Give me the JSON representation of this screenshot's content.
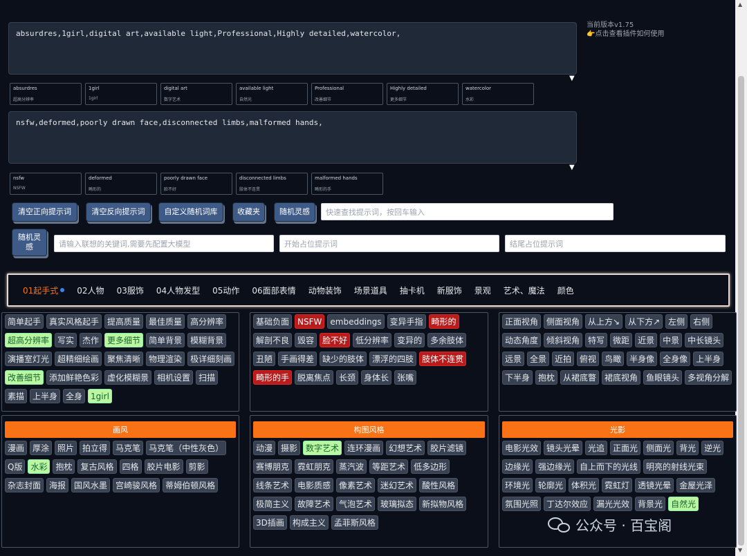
{
  "version": "当前版本v1.75",
  "guide_link": "👉点击查看插件如何使用",
  "positive_prompt": "absurdres,1girl,digital art,available  light,Professional,Highly detailed,watercolor,",
  "negative_prompt": "nsfw,deformed,poorly drawn face,disconnected limbs,malformed hands,",
  "dropdown_glyph": "▼",
  "positive_tags": [
    {
      "en": "absurdres",
      "cn": "超高分辨率"
    },
    {
      "en": "1girl",
      "cn": "1girl"
    },
    {
      "en": "digital art",
      "cn": "数字艺术"
    },
    {
      "en": "available light",
      "cn": "自然光"
    },
    {
      "en": "Professional",
      "cn": "改善细节"
    },
    {
      "en": "Highly detailed",
      "cn": "更多细节"
    },
    {
      "en": "watercolor",
      "cn": "水彩"
    }
  ],
  "negative_tags": [
    {
      "en": "nsfw",
      "cn": "NSFW"
    },
    {
      "en": "deformed",
      "cn": "畸形的"
    },
    {
      "en": "poorly drawn face",
      "cn": "脸不好"
    },
    {
      "en": "disconnected limbs",
      "cn": "肢体不连贯"
    },
    {
      "en": "malformed hands",
      "cn": "畸形的手"
    }
  ],
  "buttons": {
    "clear_positive": "清空正向提示词",
    "clear_negative": "清空反向提示词",
    "custom_random": "自定义随机词库",
    "favorites": "收藏夹",
    "random_inspiration": "随机灵感",
    "random_inspiration2": "随机灵感"
  },
  "inputs": {
    "quick_search": "快速查找提示词，按回车输入",
    "llm_keyword": "请输入联想的关键词,需要先配置大模型",
    "start_placeholder": "开始占位提示词",
    "end_placeholder": "结尾占位提示词"
  },
  "tabs": [
    "01起手式",
    "02人物",
    "03服饰",
    "04人物发型",
    "05动作",
    "06面部表情",
    "动物装饰",
    "场景道具",
    "抽卡机",
    "新服饰",
    "景观",
    "艺术、魔法",
    "颜色"
  ],
  "panels": {
    "p1": {
      "chips": [
        {
          "t": "简单起手",
          "s": ""
        },
        {
          "t": "真实风格起手",
          "s": ""
        },
        {
          "t": "提高质量",
          "s": ""
        },
        {
          "t": "最佳质量",
          "s": ""
        },
        {
          "t": "高分辨率",
          "s": ""
        },
        {
          "t": "超高分辨率",
          "s": "green"
        },
        {
          "t": "写实",
          "s": ""
        },
        {
          "t": "杰作",
          "s": ""
        },
        {
          "t": "更多细节",
          "s": "green"
        },
        {
          "t": "简单背景",
          "s": ""
        },
        {
          "t": "模糊背景",
          "s": ""
        },
        {
          "t": "演播室灯光",
          "s": ""
        },
        {
          "t": "超精细绘画",
          "s": ""
        },
        {
          "t": "聚焦清晰",
          "s": ""
        },
        {
          "t": "物理渲染",
          "s": ""
        },
        {
          "t": "极详细刻画",
          "s": ""
        },
        {
          "t": "改善细节",
          "s": "green"
        },
        {
          "t": "添加鲜艳色彩",
          "s": ""
        },
        {
          "t": "虚化模糊景",
          "s": ""
        },
        {
          "t": "相机设置",
          "s": ""
        },
        {
          "t": "扫描",
          "s": ""
        },
        {
          "t": "素描",
          "s": ""
        },
        {
          "t": "上半身",
          "s": ""
        },
        {
          "t": "全身",
          "s": ""
        },
        {
          "t": "1girl",
          "s": "green"
        }
      ]
    },
    "p2": {
      "chips": [
        {
          "t": "基础负面",
          "s": ""
        },
        {
          "t": "NSFW",
          "s": "red"
        },
        {
          "t": "embeddings",
          "s": ""
        },
        {
          "t": "变异手指",
          "s": ""
        },
        {
          "t": "畸形的",
          "s": "red"
        },
        {
          "t": "解剖不良",
          "s": ""
        },
        {
          "t": "毁容",
          "s": ""
        },
        {
          "t": "脸不好",
          "s": "red"
        },
        {
          "t": "低分辨率",
          "s": ""
        },
        {
          "t": "变异的",
          "s": ""
        },
        {
          "t": "多余肢体",
          "s": ""
        },
        {
          "t": "丑陋",
          "s": ""
        },
        {
          "t": "手画得差",
          "s": ""
        },
        {
          "t": "缺少的肢体",
          "s": ""
        },
        {
          "t": "漂浮的四肢",
          "s": ""
        },
        {
          "t": "肢体不连贯",
          "s": "red"
        },
        {
          "t": "畸形的手",
          "s": "red"
        },
        {
          "t": "脱离焦点",
          "s": ""
        },
        {
          "t": "长颈",
          "s": ""
        },
        {
          "t": "身体长",
          "s": ""
        },
        {
          "t": "张嘴",
          "s": ""
        }
      ]
    },
    "p3": {
      "chips": [
        {
          "t": "正面视角",
          "s": ""
        },
        {
          "t": "侧面视角",
          "s": ""
        },
        {
          "t": "从上方↘",
          "s": ""
        },
        {
          "t": "从下方↗",
          "s": ""
        },
        {
          "t": "左侧",
          "s": ""
        },
        {
          "t": "右侧",
          "s": ""
        },
        {
          "t": "动态角度",
          "s": ""
        },
        {
          "t": "倾斜视角",
          "s": ""
        },
        {
          "t": "特写",
          "s": ""
        },
        {
          "t": "微距",
          "s": ""
        },
        {
          "t": "近景",
          "s": ""
        },
        {
          "t": "中景",
          "s": ""
        },
        {
          "t": "中长镜头",
          "s": ""
        },
        {
          "t": "远景",
          "s": ""
        },
        {
          "t": "全景",
          "s": ""
        },
        {
          "t": "近拍",
          "s": ""
        },
        {
          "t": "俯视",
          "s": ""
        },
        {
          "t": "鸟瞰",
          "s": ""
        },
        {
          "t": "半身像",
          "s": ""
        },
        {
          "t": "全身像",
          "s": ""
        },
        {
          "t": "上半身",
          "s": ""
        },
        {
          "t": "下半身",
          "s": ""
        },
        {
          "t": "抱枕",
          "s": ""
        },
        {
          "t": "从裙底瞥",
          "s": ""
        },
        {
          "t": "裙底视角",
          "s": ""
        },
        {
          "t": "鱼眼镜头",
          "s": ""
        },
        {
          "t": "多视角分解",
          "s": ""
        }
      ]
    },
    "p4": {
      "title": "画风",
      "chips": [
        {
          "t": "漫画",
          "s": ""
        },
        {
          "t": "厚涂",
          "s": ""
        },
        {
          "t": "照片",
          "s": ""
        },
        {
          "t": "拍立得",
          "s": ""
        },
        {
          "t": "马克笔",
          "s": ""
        },
        {
          "t": "马克笔（中性灰色）",
          "s": ""
        },
        {
          "t": "Q版",
          "s": ""
        },
        {
          "t": "水彩",
          "s": "green"
        },
        {
          "t": "抱枕",
          "s": ""
        },
        {
          "t": "复古风格",
          "s": ""
        },
        {
          "t": "四格",
          "s": ""
        },
        {
          "t": "胶片电影",
          "s": ""
        },
        {
          "t": "剪影",
          "s": ""
        },
        {
          "t": "杂志封面",
          "s": ""
        },
        {
          "t": "海报",
          "s": ""
        },
        {
          "t": "国风水墨",
          "s": ""
        },
        {
          "t": "宫崎骏风格",
          "s": ""
        },
        {
          "t": "蒂姆伯顿风格",
          "s": ""
        }
      ]
    },
    "p5": {
      "title": "构图风格",
      "chips": [
        {
          "t": "动漫",
          "s": ""
        },
        {
          "t": "摄影",
          "s": ""
        },
        {
          "t": "数字艺术",
          "s": "green"
        },
        {
          "t": "连环漫画",
          "s": ""
        },
        {
          "t": "幻想艺术",
          "s": ""
        },
        {
          "t": "胶片滤镜",
          "s": ""
        },
        {
          "t": "赛博朋克",
          "s": ""
        },
        {
          "t": "霓虹朋克",
          "s": ""
        },
        {
          "t": "蒸汽波",
          "s": ""
        },
        {
          "t": "等距艺术",
          "s": ""
        },
        {
          "t": "低多边形",
          "s": ""
        },
        {
          "t": "线条艺术",
          "s": ""
        },
        {
          "t": "电影质感",
          "s": ""
        },
        {
          "t": "像素艺术",
          "s": ""
        },
        {
          "t": "迷幻艺术",
          "s": ""
        },
        {
          "t": "酸性风格",
          "s": ""
        },
        {
          "t": "极简主义",
          "s": ""
        },
        {
          "t": "故障艺术",
          "s": ""
        },
        {
          "t": "气泡艺术",
          "s": ""
        },
        {
          "t": "玻璃拟态",
          "s": ""
        },
        {
          "t": "新拟物风格",
          "s": ""
        },
        {
          "t": "3D插画",
          "s": ""
        },
        {
          "t": "构成主义",
          "s": ""
        },
        {
          "t": "孟菲斯风格",
          "s": ""
        }
      ]
    },
    "p6": {
      "title": "光影",
      "chips": [
        {
          "t": "电影光效",
          "s": ""
        },
        {
          "t": "镜头光晕",
          "s": ""
        },
        {
          "t": "光追",
          "s": ""
        },
        {
          "t": "正面光",
          "s": ""
        },
        {
          "t": "侧面光",
          "s": ""
        },
        {
          "t": "背光",
          "s": ""
        },
        {
          "t": "逆光",
          "s": ""
        },
        {
          "t": "边缘光",
          "s": ""
        },
        {
          "t": "强边缘光",
          "s": ""
        },
        {
          "t": "自上而下的光线",
          "s": ""
        },
        {
          "t": "明亮的射线光束",
          "s": ""
        },
        {
          "t": "环境光",
          "s": ""
        },
        {
          "t": "轮廓光",
          "s": ""
        },
        {
          "t": "体积光",
          "s": ""
        },
        {
          "t": "霓虹灯",
          "s": ""
        },
        {
          "t": "透镜光晕",
          "s": ""
        },
        {
          "t": "金屋光泽",
          "s": ""
        },
        {
          "t": "氛围光照",
          "s": ""
        },
        {
          "t": "丁达尔效应",
          "s": ""
        },
        {
          "t": "漏光光效",
          "s": ""
        },
        {
          "t": "背景光",
          "s": ""
        },
        {
          "t": "自然光",
          "s": "green"
        }
      ]
    }
  },
  "watermark": "公众号 · 百宝阁"
}
